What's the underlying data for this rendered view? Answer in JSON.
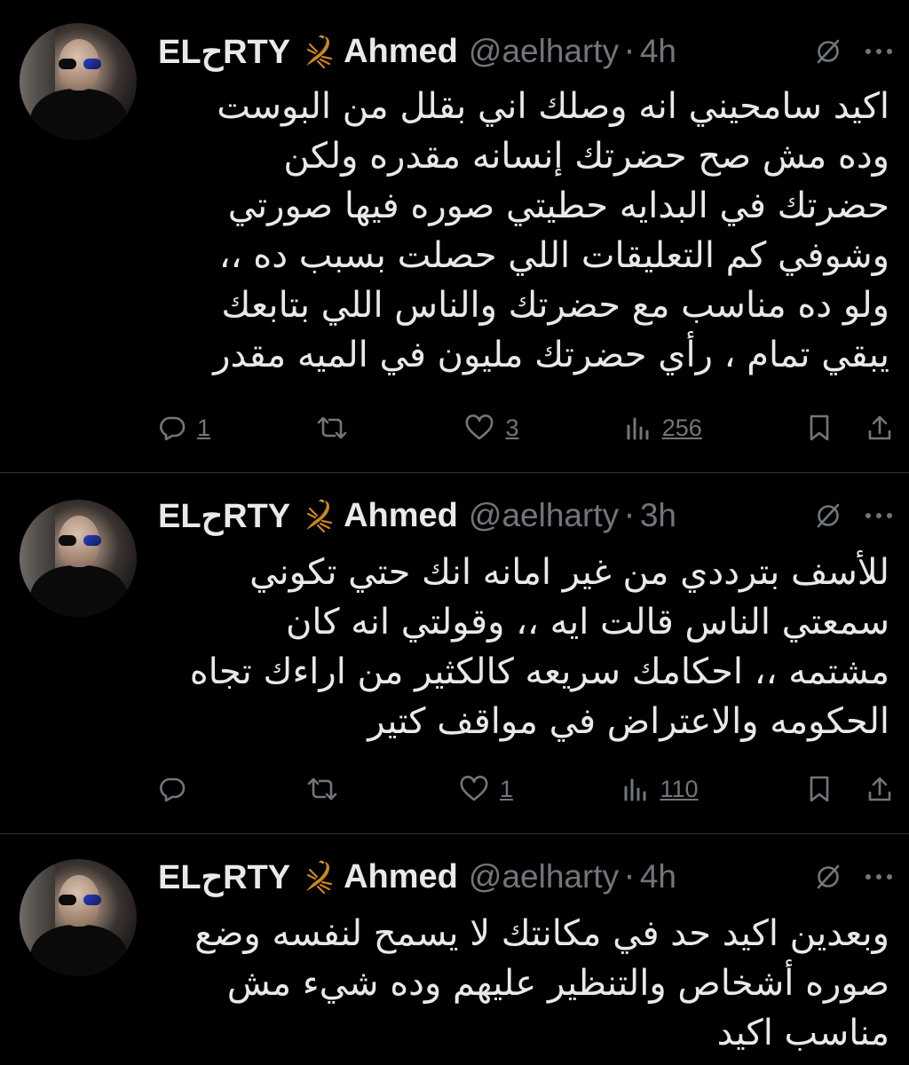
{
  "tweets": [
    {
      "author_name_left": "ELحRTY",
      "author_name_right": "Ahmed",
      "handle": "@aelharty",
      "separator": "·",
      "time": "4h",
      "lines": [
        "اكيد سامحيني انه وصلك اني بقلل من البوست",
        "وده مش صح حضرتك إنسانه مقدره ولكن",
        "حضرتك في البدايه حطيتي صوره فيها صورتي",
        "وشوفي كم التعليقات اللي حصلت بسبب ده ،،",
        "ولو ده مناسب مع حضرتك والناس اللي بتابعك",
        "يبقي تمام ، رأي حضرتك مليون في الميه مقدر"
      ],
      "replies": "1",
      "retweets": "",
      "likes": "3",
      "views": "256"
    },
    {
      "author_name_left": "ELحRTY",
      "author_name_right": "Ahmed",
      "handle": "@aelharty",
      "separator": "·",
      "time": "3h",
      "lines": [
        "للأسف بترددي من غير امانه انك حتي تكوني",
        "سمعتي الناس قالت ايه ،، وقولتي انه كان",
        "مشتمه ،، احكامك سريعه كالكثير من اراءك تجاه",
        "الحكومه والاعتراض في مواقف كتير"
      ],
      "replies": "",
      "retweets": "",
      "likes": "1",
      "views": "110"
    },
    {
      "author_name_left": "ELحRTY",
      "author_name_right": "Ahmed",
      "handle": "@aelharty",
      "separator": "·",
      "time": "4h",
      "lines": [
        "وبعدين اكيد حد في مكانتك لا يسمح لنفسه وضع",
        "صوره أشخاص والتنظير عليهم وده شيء مش",
        "مناسب اكيد"
      ]
    }
  ],
  "icons": {
    "name_emoji": "scorpion-icon",
    "grok": "grok-icon",
    "more": "more-icon",
    "reply": "reply-icon",
    "retweet": "retweet-icon",
    "like": "heart-icon",
    "views": "views-icon",
    "bookmark": "bookmark-icon",
    "share": "share-icon"
  },
  "colors": {
    "background": "#000000",
    "text": "#e7e9ea",
    "secondary": "#71767b",
    "divider": "#2f3336",
    "scorpion": "#c8871e"
  }
}
